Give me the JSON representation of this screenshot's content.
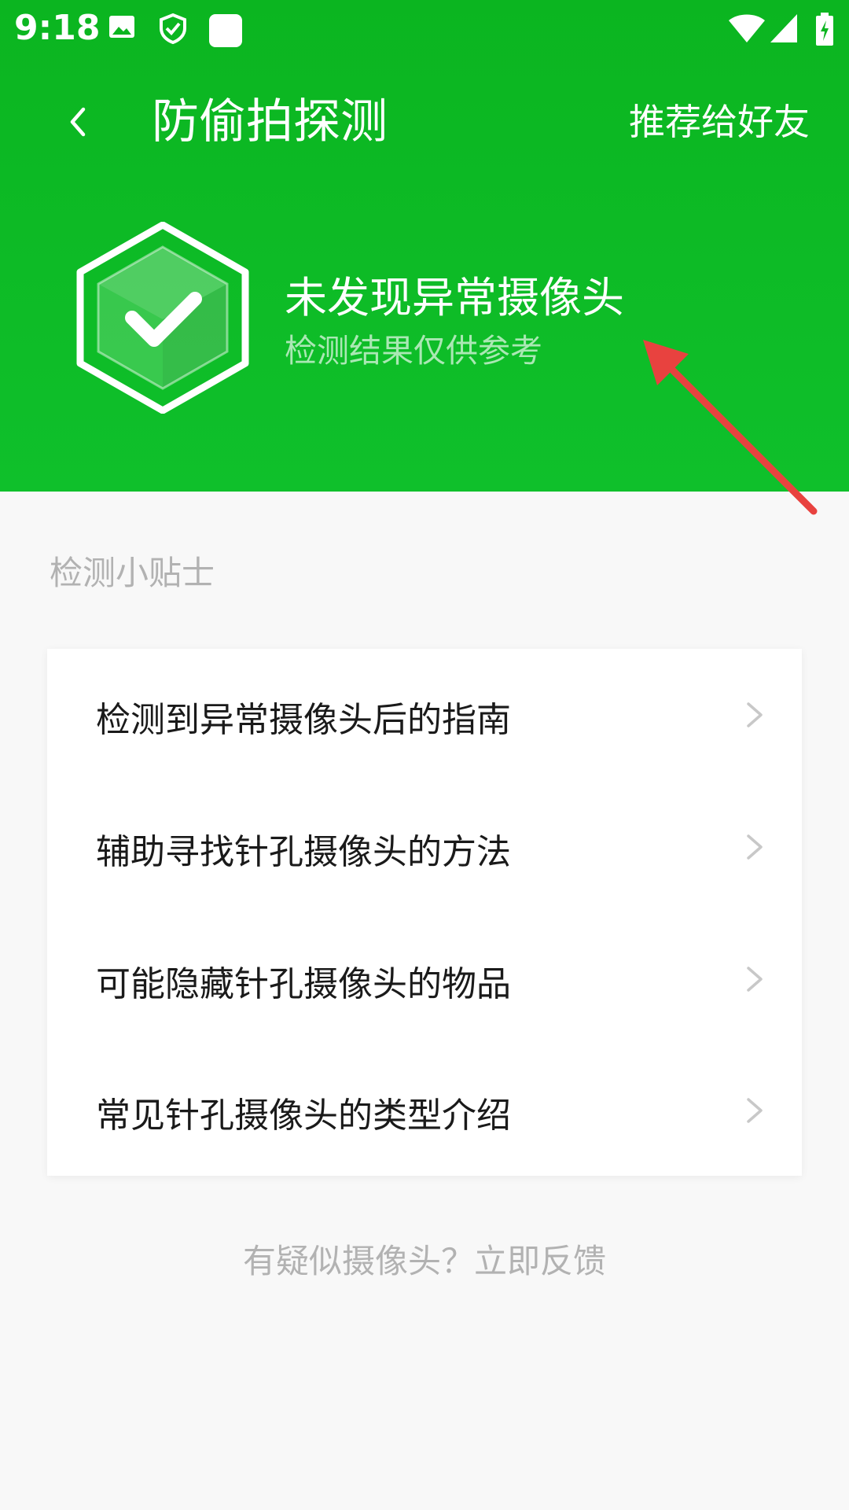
{
  "status_bar": {
    "time": "9:18"
  },
  "nav": {
    "title": "防偷拍探测",
    "share_label": "推荐给好友"
  },
  "result": {
    "title": "未发现异常摄像头",
    "subtitle": "检测结果仅供参考"
  },
  "tips": {
    "heading": "检测小贴士",
    "items": [
      {
        "label": "检测到异常摄像头后的指南"
      },
      {
        "label": "辅助寻找针孔摄像头的方法"
      },
      {
        "label": "可能隐藏针孔摄像头的物品"
      },
      {
        "label": "常见针孔摄像头的类型介绍"
      }
    ]
  },
  "feedback": {
    "label": "有疑似摄像头？立即反馈"
  },
  "colors": {
    "accent": "#0bb520",
    "arrow": "#e8423f"
  }
}
